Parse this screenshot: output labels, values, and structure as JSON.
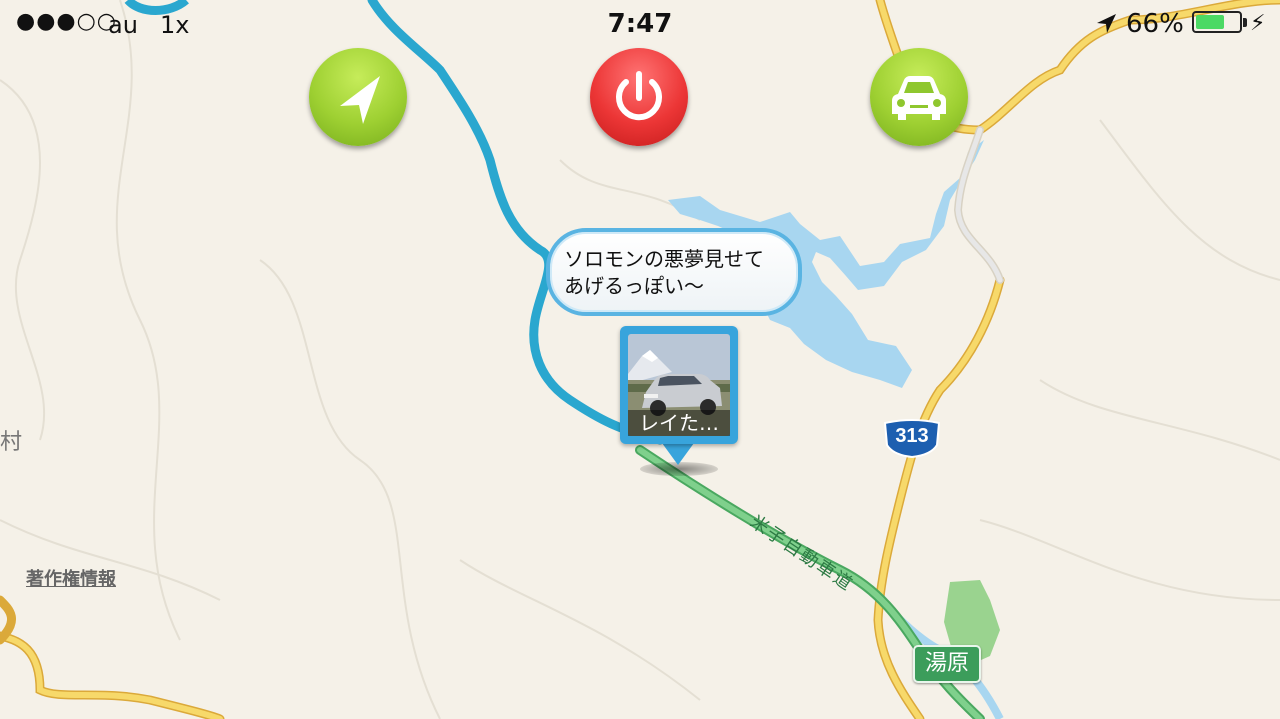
{
  "status_bar": {
    "signal": "●●●○○",
    "carrier": "au",
    "speed": "1x",
    "time": "7:47",
    "battery_pct": "66%",
    "battery_level": 0.66,
    "location_icon": "location-arrow-icon",
    "charging_icon": "bolt-icon"
  },
  "buttons": {
    "navigate": {
      "icon": "navigation-arrow-icon",
      "color": "#9ed032"
    },
    "power": {
      "icon": "power-icon",
      "color": "#ec3636"
    },
    "car": {
      "icon": "car-icon",
      "color": "#9ed032"
    }
  },
  "bubble": {
    "text_line1": "ソロモンの悪夢見せて",
    "text_line2": "あげるっぽい〜"
  },
  "pin": {
    "caption": "レイた…",
    "color": "#38a4dc"
  },
  "map": {
    "place_partial": "村",
    "copyright": "著作権情報",
    "route_number": "313",
    "expressway_label": "米子自動車道",
    "interchange": "湯原",
    "colors": {
      "land": "#f5f1e8",
      "water": "#a8d6f0",
      "track": "#2aa7cf",
      "expressway": "#6fc87c",
      "road": "#f4c84e",
      "park": "#9ad38f"
    }
  }
}
